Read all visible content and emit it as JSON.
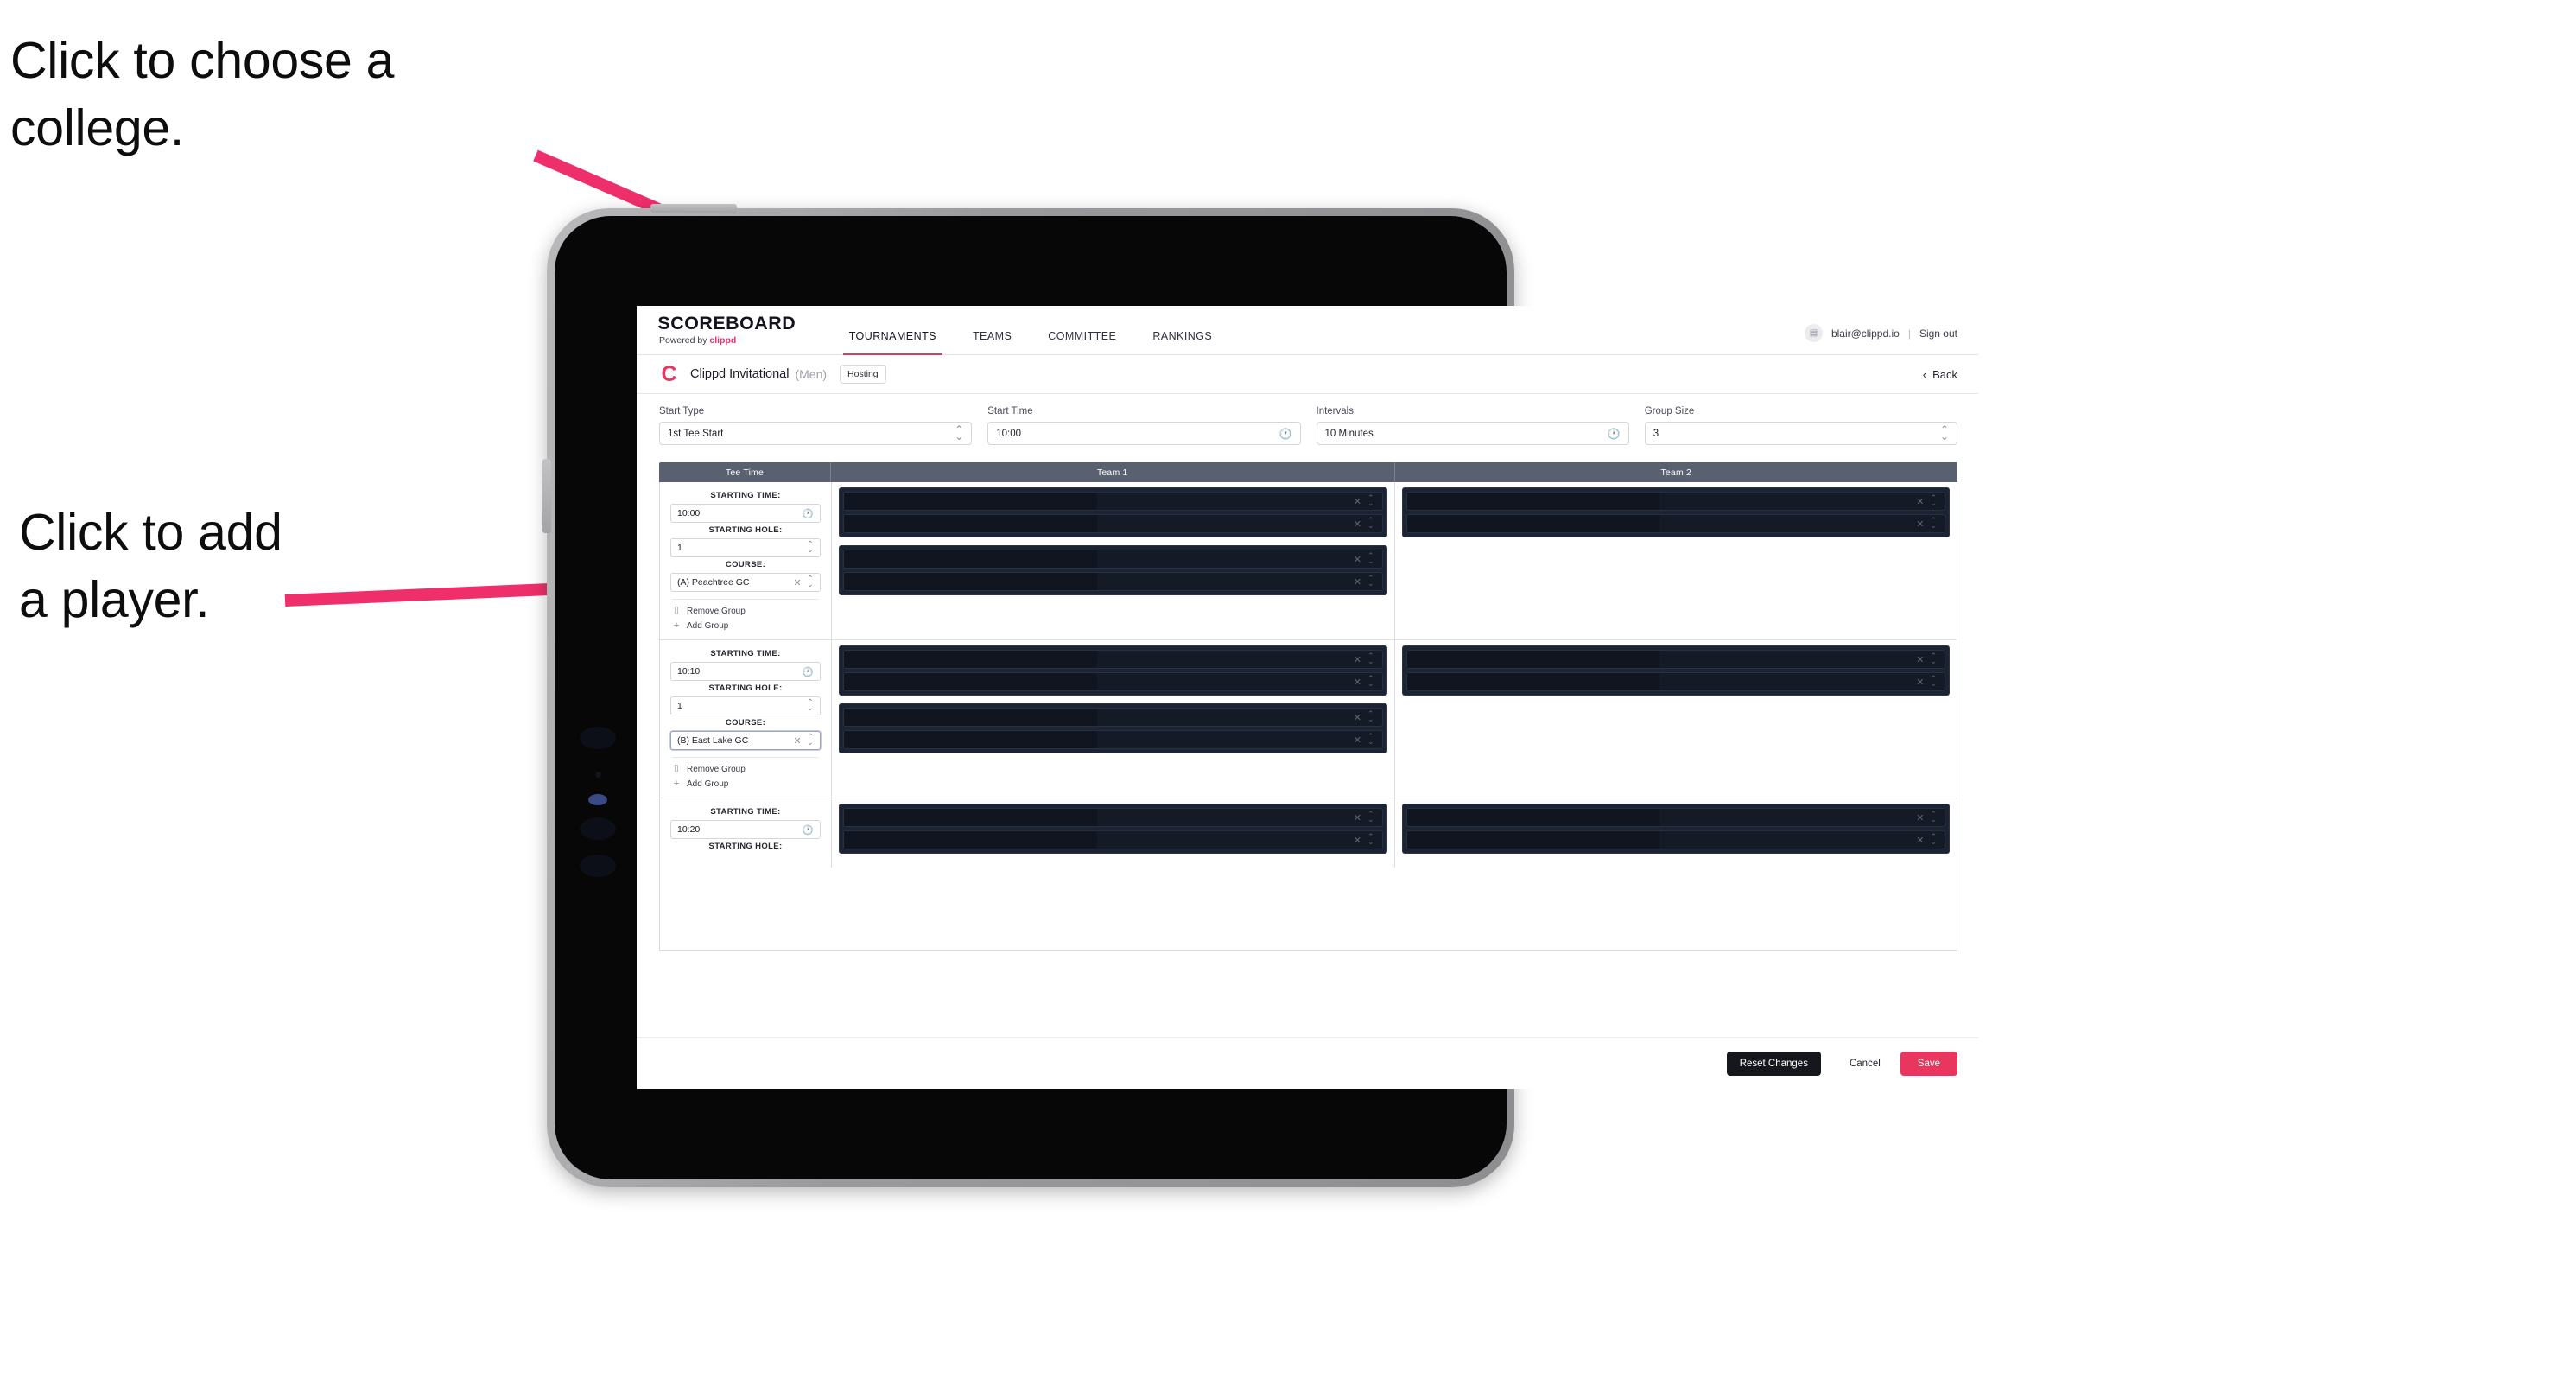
{
  "annotations": [
    {
      "id": "college",
      "text": "Click to choose a\ncollege."
    },
    {
      "id": "player",
      "text": "Click to add\na player."
    }
  ],
  "accent": "#e8365e",
  "app": {
    "nav": {
      "brand_title": "SCOREBOARD",
      "brand_sub_prefix": "Powered by ",
      "brand_sub_brand": "clippd",
      "links": [
        {
          "label": "TOURNAMENTS",
          "active": true
        },
        {
          "label": "TEAMS",
          "active": false
        },
        {
          "label": "COMMITTEE",
          "active": false
        },
        {
          "label": "RANKINGS",
          "active": false
        }
      ],
      "avatar_glyph": "▤",
      "user_email": "blair@clippd.io",
      "separator": "|",
      "sign_out": "Sign out"
    },
    "title_bar": {
      "logo_glyph": "C",
      "title": "Clippd Invitational",
      "gender": "(Men)",
      "badge": "Hosting",
      "back_chevron": "‹",
      "back_label": "Back"
    },
    "form": [
      {
        "label": "Start Type",
        "value": "1st Tee Start",
        "adorn": "spinner"
      },
      {
        "label": "Start Time",
        "value": "10:00",
        "adorn": "clock"
      },
      {
        "label": "Intervals",
        "value": "10 Minutes",
        "adorn": "clock"
      },
      {
        "label": "Group Size",
        "value": "3",
        "adorn": "spinner"
      }
    ],
    "table": {
      "headers": [
        "Tee Time",
        "Team 1",
        "Team 2"
      ],
      "labels": {
        "starting_time": "STARTING TIME:",
        "starting_hole": "STARTING HOLE:",
        "course": "COURSE:",
        "remove_group": "Remove Group",
        "add_group": "Add Group",
        "trash_glyph": "⌷",
        "plus_glyph": "+",
        "clear_glyph": "✕"
      },
      "groups": [
        {
          "starting_time": "10:00",
          "starting_hole": "1",
          "course": "(A) Peachtree GC",
          "course_focused": false,
          "team1_blocks": [
            2,
            2
          ],
          "team2_blocks": [
            2
          ]
        },
        {
          "starting_time": "10:10",
          "starting_hole": "1",
          "course": "(B) East Lake GC",
          "course_focused": true,
          "team1_blocks": [
            2,
            2
          ],
          "team2_blocks": [
            2
          ]
        },
        {
          "starting_time": "10:20",
          "starting_hole": "",
          "course": "",
          "course_focused": false,
          "team1_blocks": [
            2
          ],
          "team2_blocks": [
            2
          ]
        }
      ]
    },
    "footer": {
      "reset": "Reset Changes",
      "cancel": "Cancel",
      "save": "Save"
    }
  }
}
